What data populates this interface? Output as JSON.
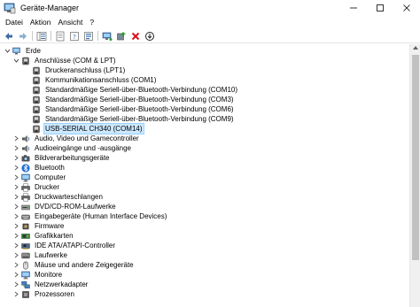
{
  "window": {
    "title": "Geräte-Manager",
    "controls": [
      "minimize",
      "maximize",
      "close"
    ]
  },
  "menu": [
    {
      "label": "Datei"
    },
    {
      "label": "Aktion"
    },
    {
      "label": "Ansicht"
    },
    {
      "label": "?"
    }
  ],
  "toolbar": {
    "buttons": [
      "back-icon",
      "forward-icon",
      "tree-view-icon",
      "properties-icon",
      "help-icon",
      "show-hidden-icon",
      "monitor-scan-icon",
      "update-driver-icon",
      "uninstall-icon",
      "disable-icon"
    ]
  },
  "tree": {
    "root": "Erde",
    "items": [
      {
        "label": "Anschlüsse (COM & LPT)",
        "level": 1,
        "expanded": true,
        "icon": "port-icon"
      },
      {
        "label": "Druckeranschluss (LPT1)",
        "level": 2,
        "icon": "port-icon"
      },
      {
        "label": "Kommunikationsanschluss (COM1)",
        "level": 2,
        "icon": "port-icon"
      },
      {
        "label": "Standardmäßige Seriell-über-Bluetooth-Verbindung (COM10)",
        "level": 2,
        "icon": "port-icon"
      },
      {
        "label": "Standardmäßige Seriell-über-Bluetooth-Verbindung (COM3)",
        "level": 2,
        "icon": "port-icon"
      },
      {
        "label": "Standardmäßige Seriell-über-Bluetooth-Verbindung (COM6)",
        "level": 2,
        "icon": "port-icon"
      },
      {
        "label": "Standardmäßige Seriell-über-Bluetooth-Verbindung (COM9)",
        "level": 2,
        "icon": "port-icon"
      },
      {
        "label": "USB-SERIAL CH340 (COM14)",
        "level": 2,
        "icon": "port-icon",
        "selected": true
      },
      {
        "label": "Audio, Video und Gamecontroller",
        "level": 1,
        "icon": "speaker-icon"
      },
      {
        "label": "Audioeingänge und -ausgänge",
        "level": 1,
        "icon": "speaker-icon"
      },
      {
        "label": "Bildverarbeitungsgeräte",
        "level": 1,
        "icon": "camera-icon"
      },
      {
        "label": "Bluetooth",
        "level": 1,
        "icon": "bluetooth-icon"
      },
      {
        "label": "Computer",
        "level": 1,
        "icon": "monitor-icon"
      },
      {
        "label": "Drucker",
        "level": 1,
        "icon": "printer-icon"
      },
      {
        "label": "Druckwarteschlangen",
        "level": 1,
        "icon": "printer-icon"
      },
      {
        "label": "DVD/CD-ROM-Laufwerke",
        "level": 1,
        "icon": "disc-icon"
      },
      {
        "label": "Eingabegeräte (Human Interface Devices)",
        "level": 1,
        "icon": "hid-icon"
      },
      {
        "label": "Firmware",
        "level": 1,
        "icon": "chip-icon"
      },
      {
        "label": "Grafikkarten",
        "level": 1,
        "icon": "display-adapter-icon"
      },
      {
        "label": "IDE ATA/ATAPI-Controller",
        "level": 1,
        "icon": "controller-icon"
      },
      {
        "label": "Laufwerke",
        "level": 1,
        "icon": "drive-icon"
      },
      {
        "label": "Mäuse und andere Zeigegeräte",
        "level": 1,
        "icon": "mouse-icon"
      },
      {
        "label": "Monitore",
        "level": 1,
        "icon": "monitor-icon"
      },
      {
        "label": "Netzwerkadapter",
        "level": 1,
        "icon": "network-icon"
      },
      {
        "label": "Prozessoren",
        "level": 1,
        "icon": "cpu-icon"
      }
    ]
  },
  "colors": {
    "selection": "#cce8ff",
    "selection_border": "#99d1ff",
    "close_red": "#e81123",
    "scrollbar_thumb": "#c1c1c1"
  }
}
